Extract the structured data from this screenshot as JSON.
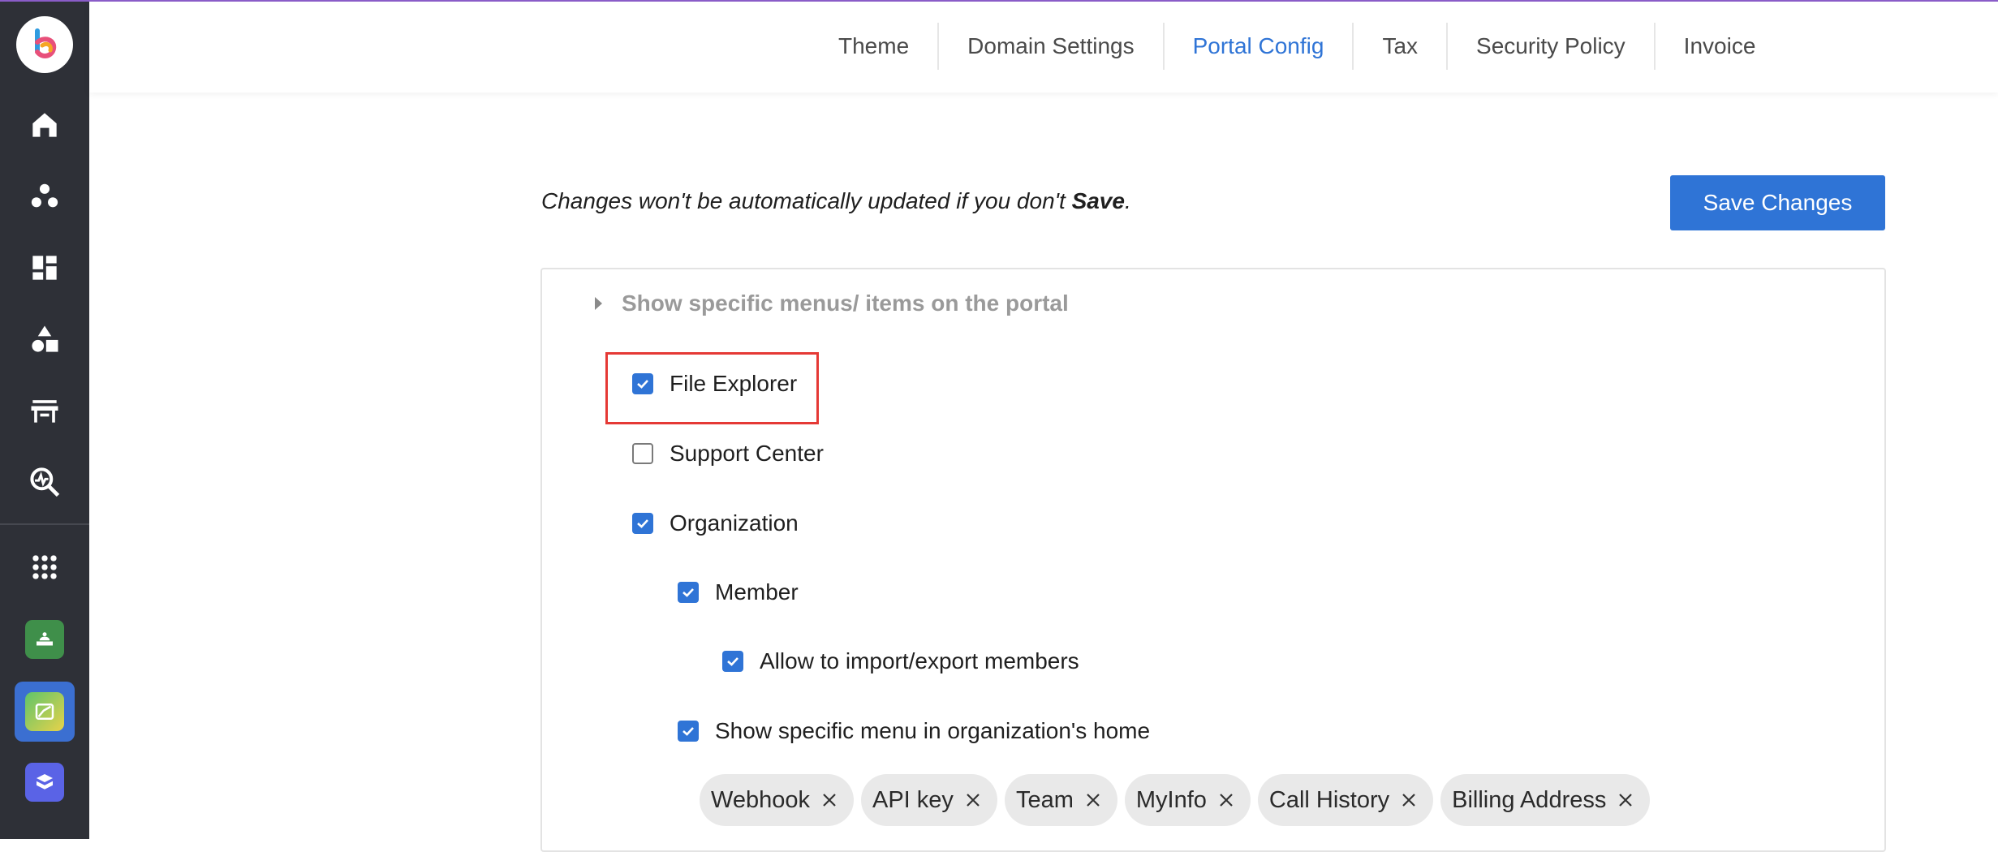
{
  "tabs": [
    "Theme",
    "Domain Settings",
    "Portal Config",
    "Tax",
    "Security Policy",
    "Invoice"
  ],
  "active_tab": "Portal Config",
  "note": {
    "prefix": "Changes won't be automatically updated if you don't ",
    "bold": "Save",
    "suffix": "."
  },
  "save_label": "Save Changes",
  "section": {
    "title": "Show specific menus/ items on the portal"
  },
  "options": {
    "file_explorer": {
      "label": "File Explorer",
      "checked": true
    },
    "support_center": {
      "label": "Support Center",
      "checked": false
    },
    "organization": {
      "label": "Organization",
      "checked": true
    },
    "member": {
      "label": "Member",
      "checked": true
    },
    "import_export": {
      "label": "Allow to import/export members",
      "checked": true
    },
    "org_home_menu": {
      "label": "Show specific menu in organization's home",
      "checked": true
    }
  },
  "chips": [
    "Webhook",
    "API key",
    "Team",
    "MyInfo",
    "Call History",
    "Billing Address"
  ],
  "colors": {
    "accent": "#2f74d6",
    "sidebar": "#2e3037",
    "highlight": "#e53935"
  },
  "sidebar_icons": [
    "home-icon",
    "groups-icon",
    "dashboard-icon",
    "shapes-icon",
    "store-icon",
    "analytics-search-icon",
    "apps-grid-icon",
    "green-app-icon",
    "image-app-icon",
    "box-app-icon"
  ]
}
